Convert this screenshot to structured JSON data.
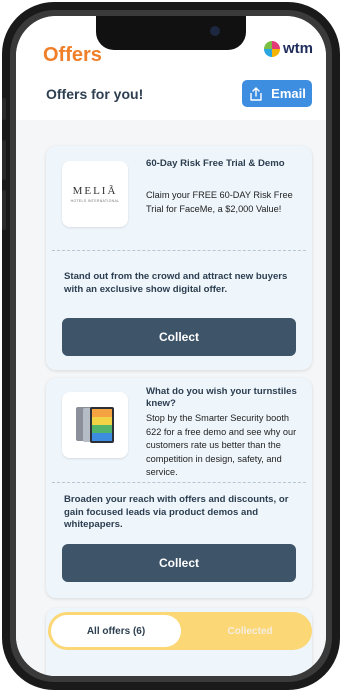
{
  "app": {
    "brand": "Offers",
    "logo_text": "wtm"
  },
  "header": {
    "title": "Offers for you!",
    "email_label": "Email",
    "email_icon": "upload-icon"
  },
  "offers": [
    {
      "thumb_brand": "MELIÃ",
      "thumb_sub": "HOTELS INTERNATIONAL",
      "title": "60-Day  Risk  Free  Trial & Demo",
      "description": "Claim your FREE 60-DAY Risk Free Trial for FaceMe, a $2,000 Value!",
      "pitch": "Stand out from the crowd and attract new buyers with an exclusive show digital offer.",
      "button": "Collect"
    },
    {
      "thumb_icon": "tablet-devices-icon",
      "title": "What do you wish your turnstiles knew?",
      "description": "Stop by  the Smarter Security booth 622 for a free demo and see why  our customers rate us better than the competition  in design,  safety, and service.",
      "pitch": "Broaden your reach with offers and discounts, or gain focused leads via product demos and whitepapers.",
      "button": "Collect"
    }
  ],
  "tabs": {
    "all": "All offers (6)",
    "collected": "Collected"
  },
  "colors": {
    "brand": "#f07f2a",
    "accent": "#3d8de0",
    "button": "#3e5468",
    "tabs_bg": "#fbd776"
  }
}
